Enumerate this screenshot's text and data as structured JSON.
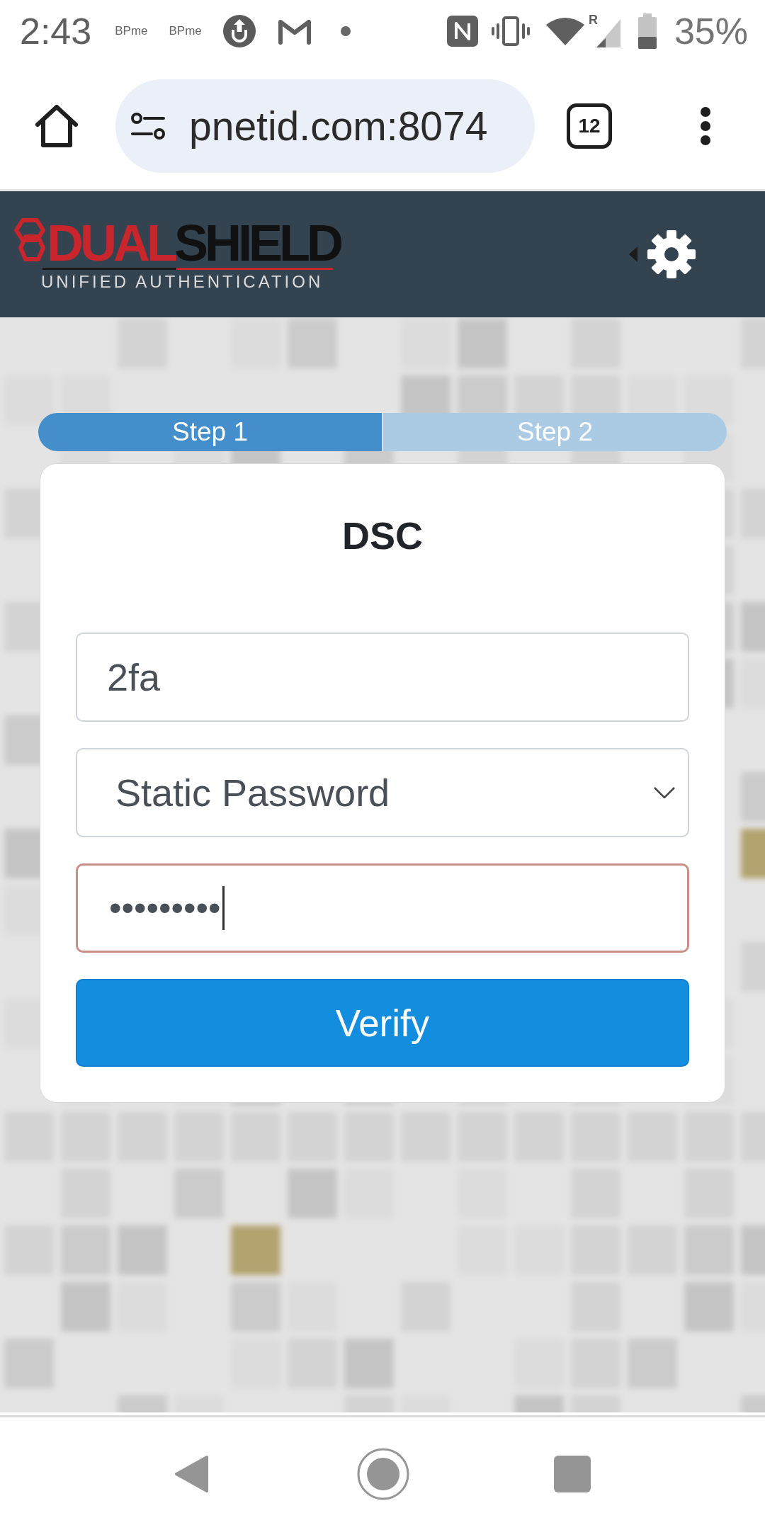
{
  "status_bar": {
    "time": "2:43",
    "notification_labels": [
      "BPme",
      "BPme"
    ],
    "roaming_label": "R",
    "battery_text": "35%"
  },
  "browser": {
    "url": "pnetid.com:8074",
    "tab_count": "12"
  },
  "header": {
    "logo": {
      "wordmark": [
        {
          "text": "DUAL",
          "color": "#c9252c"
        },
        {
          "text": "SHIELD",
          "color": "#111111"
        }
      ],
      "tagline": "UNIFIED AUTHENTICATION"
    }
  },
  "steps": [
    {
      "label": "Step 1",
      "selected": true
    },
    {
      "label": "Step 2",
      "selected": false
    }
  ],
  "card": {
    "title": "DSC",
    "username": {
      "value": "2fa"
    },
    "method": {
      "value": "Static Password"
    },
    "password": {
      "masked_value": "•••••••••",
      "focused": true
    },
    "submit_button": "Verify"
  }
}
